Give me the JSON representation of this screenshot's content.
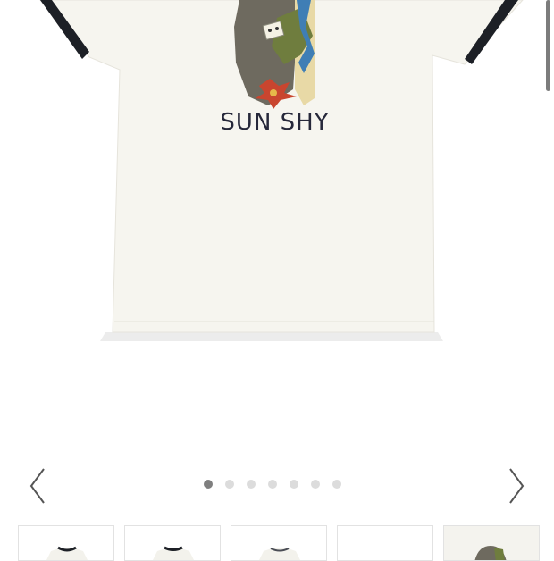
{
  "product": {
    "print_text": "SUN SHY"
  },
  "carousel": {
    "prev_icon": "chevron-left-icon",
    "next_icon": "chevron-right-icon",
    "dot_count": 7,
    "active_index": 0
  },
  "thumbnails": [
    {
      "icon": "tee-front-thumbnail"
    },
    {
      "icon": "tee-back-thumbnail"
    },
    {
      "icon": "tee-flat-thumbnail"
    },
    {
      "icon": "blank-thumbnail"
    },
    {
      "icon": "print-detail-thumbnail"
    }
  ],
  "colors": {
    "shirt": "#f6f5ef",
    "trim": "#1d2026",
    "active_dot": "#7f7f7f",
    "inactive_dot": "#dcdcdc"
  }
}
